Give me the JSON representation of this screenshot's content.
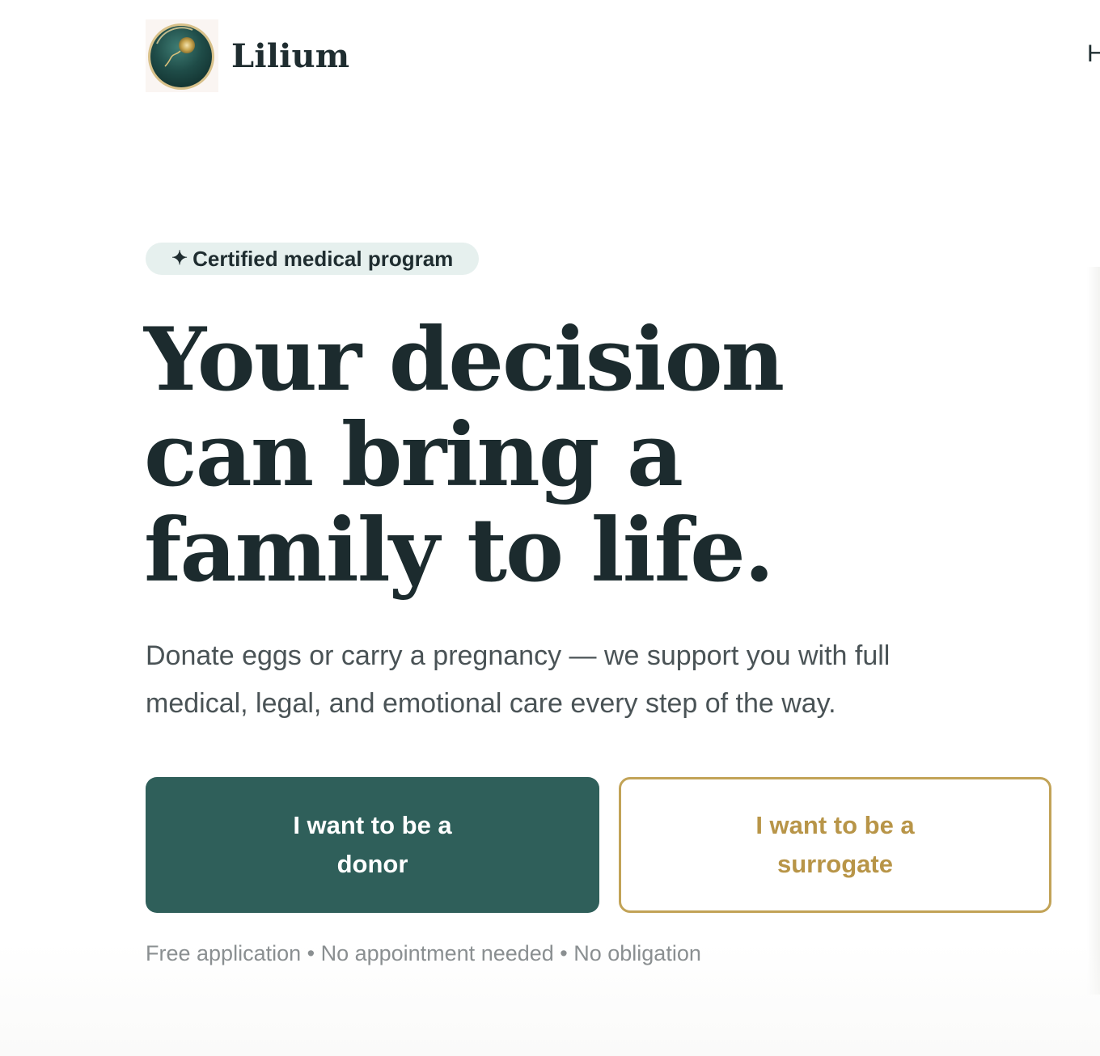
{
  "brand": {
    "name": "Lilium",
    "logo_icon": "orb-logo-icon",
    "colors": {
      "primary": "#2f5f5a",
      "accent_gold": "#c2a357",
      "text_dark": "#1c2b2e",
      "badge_bg": "#e6f0ee"
    }
  },
  "nav": {
    "first_item_partial": "H"
  },
  "hero": {
    "badge": {
      "icon": "sparkle-icon",
      "icon_glyph": "✦",
      "label": "Certified medical program"
    },
    "headline": "Your decision can bring a family to life.",
    "subtitle": "Donate eggs or carry a pregnancy — we support you with full medical, legal, and emotional care every step of the way.",
    "cta_primary": "I want to be a donor",
    "cta_secondary": "I want to be a surrogate",
    "reassurance": "Free application • No appointment needed • No obligation"
  }
}
